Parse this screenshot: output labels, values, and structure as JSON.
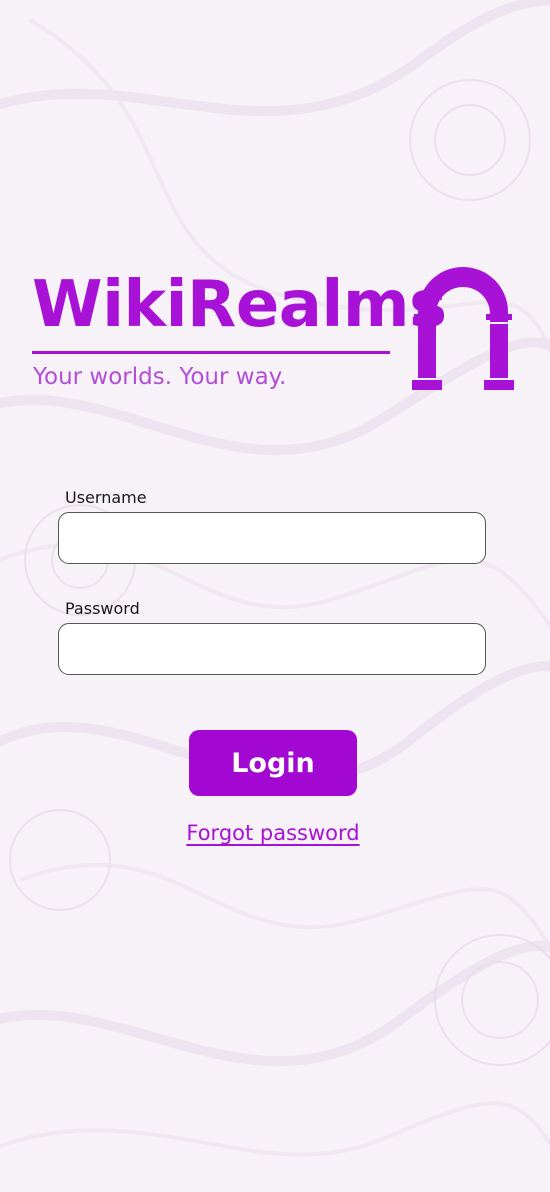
{
  "brand": {
    "title": "WikiRealms",
    "tagline": "Your worlds. Your way."
  },
  "form": {
    "username_label": "Username",
    "username_value": "",
    "username_placeholder": "",
    "password_label": "Password",
    "password_value": "",
    "password_placeholder": "",
    "login_label": "Login",
    "forgot_label": "Forgot password"
  },
  "colors": {
    "accent": "#a812d6",
    "button": "#a208d2",
    "background": "#f7f1f8"
  },
  "icons": {
    "logo": "arch-icon"
  }
}
